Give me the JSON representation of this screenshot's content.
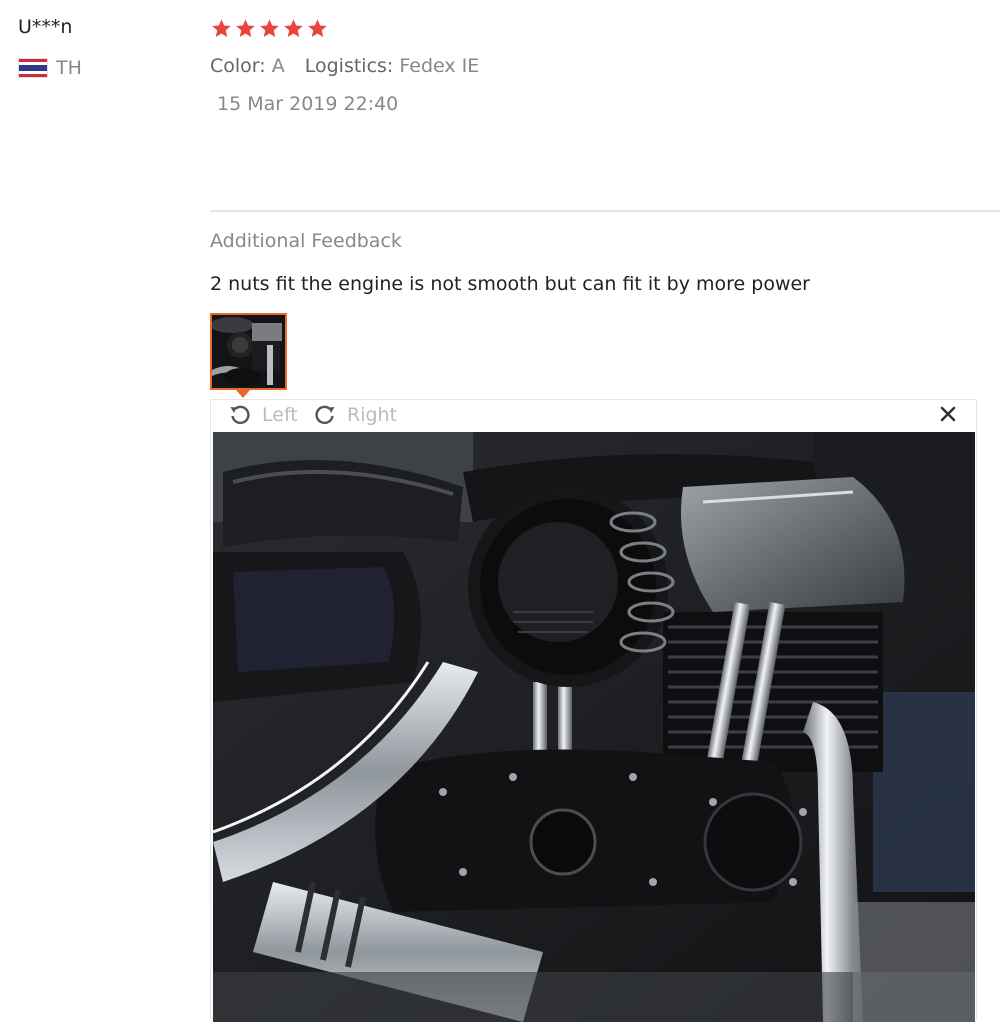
{
  "reviewer": {
    "name": "U***n",
    "country": "TH"
  },
  "review": {
    "rating": 5,
    "color_label": "Color:",
    "color_value": "A",
    "logistics_label": "Logistics:",
    "logistics_value": "Fedex IE",
    "date": "15 Mar 2019 22:40"
  },
  "additional": {
    "title": "Additional Feedback",
    "text": "2 nuts fit the engine is not smooth but can fit it by more power"
  },
  "viewer": {
    "rotate_left_label": "Left",
    "rotate_right_label": "Right"
  },
  "colors": {
    "star": "#e8453c",
    "thumb_border": "#e8692d"
  }
}
